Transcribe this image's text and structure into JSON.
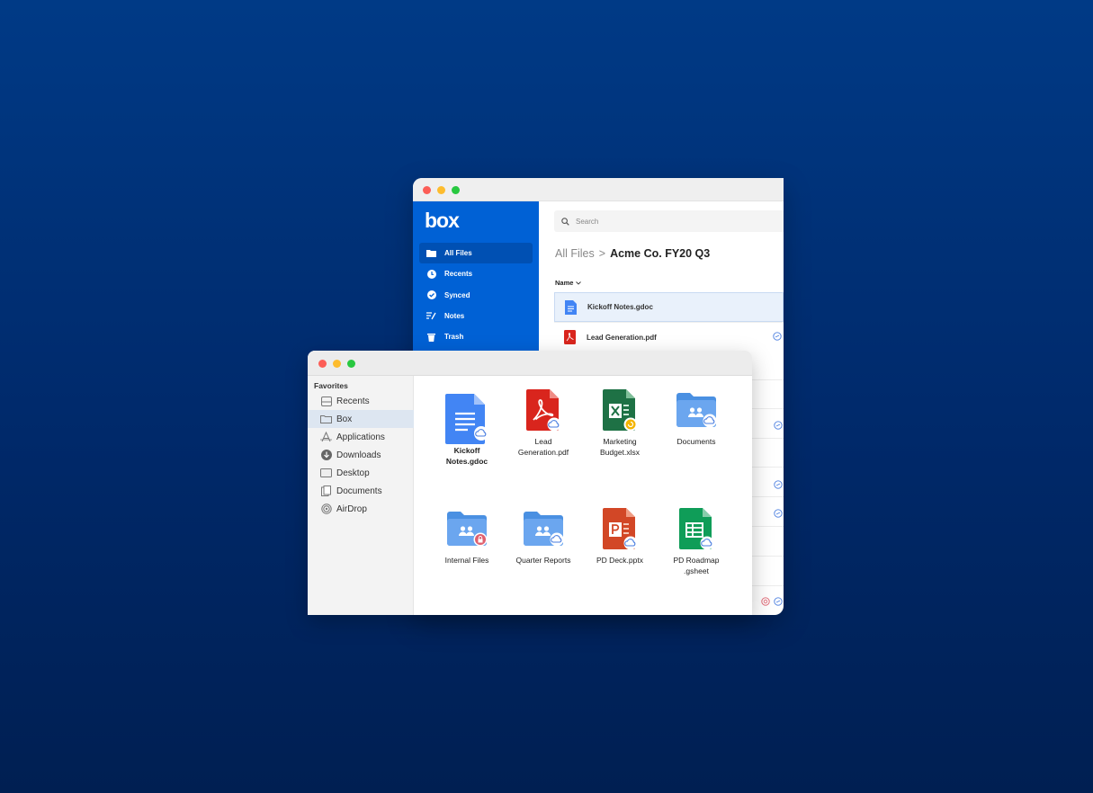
{
  "box_app": {
    "logo": "box",
    "nav": [
      {
        "label": "All Files",
        "icon": "folder-icon",
        "active": true
      },
      {
        "label": "Recents",
        "icon": "clock-icon",
        "active": false
      },
      {
        "label": "Synced",
        "icon": "check-circle-icon",
        "active": false
      },
      {
        "label": "Notes",
        "icon": "notes-icon",
        "active": false
      },
      {
        "label": "Trash",
        "icon": "trash-icon",
        "active": false
      }
    ],
    "search_placeholder": "Search",
    "breadcrumb": {
      "root": "All Files",
      "separator": ">",
      "current": "Acme Co. FY20 Q3"
    },
    "column_header": "Name",
    "files": [
      {
        "name": "Kickoff Notes.gdoc",
        "type": "gdoc",
        "selected": true
      },
      {
        "name": "Lead Generation.pdf",
        "type": "pdf",
        "selected": false
      }
    ]
  },
  "finder": {
    "sidebar_heading": "Favorites",
    "favorites": [
      {
        "label": "Recents",
        "icon": "recents-icon",
        "active": false
      },
      {
        "label": "Box",
        "icon": "folder-icon",
        "active": true
      },
      {
        "label": "Applications",
        "icon": "applications-icon",
        "active": false
      },
      {
        "label": "Downloads",
        "icon": "download-icon",
        "active": false
      },
      {
        "label": "Desktop",
        "icon": "desktop-icon",
        "active": false
      },
      {
        "label": "Documents",
        "icon": "document-icon",
        "active": false
      },
      {
        "label": "AirDrop",
        "icon": "airdrop-icon",
        "active": false
      }
    ],
    "items": [
      {
        "label": "Kickoff\nNotes.gdoc",
        "type": "gdoc",
        "selected": true
      },
      {
        "label": "Lead\nGeneration.pdf",
        "type": "pdf",
        "selected": false
      },
      {
        "label": "Marketing\nBudget.xlsx",
        "type": "xlsx",
        "selected": false
      },
      {
        "label": "Documents",
        "type": "folder",
        "selected": false
      },
      {
        "label": "Internal Files",
        "type": "folder-locked",
        "selected": false
      },
      {
        "label": "Quarter Reports",
        "type": "folder",
        "selected": false
      },
      {
        "label": "PD Deck.pptx",
        "type": "pptx",
        "selected": false
      },
      {
        "label": "PD Roadmap\n.gsheet",
        "type": "gsheet",
        "selected": false
      }
    ]
  },
  "colors": {
    "background": "#003a86",
    "box_blue": "#0061d5",
    "gdoc": "#4285f4",
    "pdf": "#d9251d",
    "xlsx": "#1e7145",
    "pptx": "#d24726",
    "gsheet": "#0f9d58",
    "folder": "#4a90e2"
  }
}
